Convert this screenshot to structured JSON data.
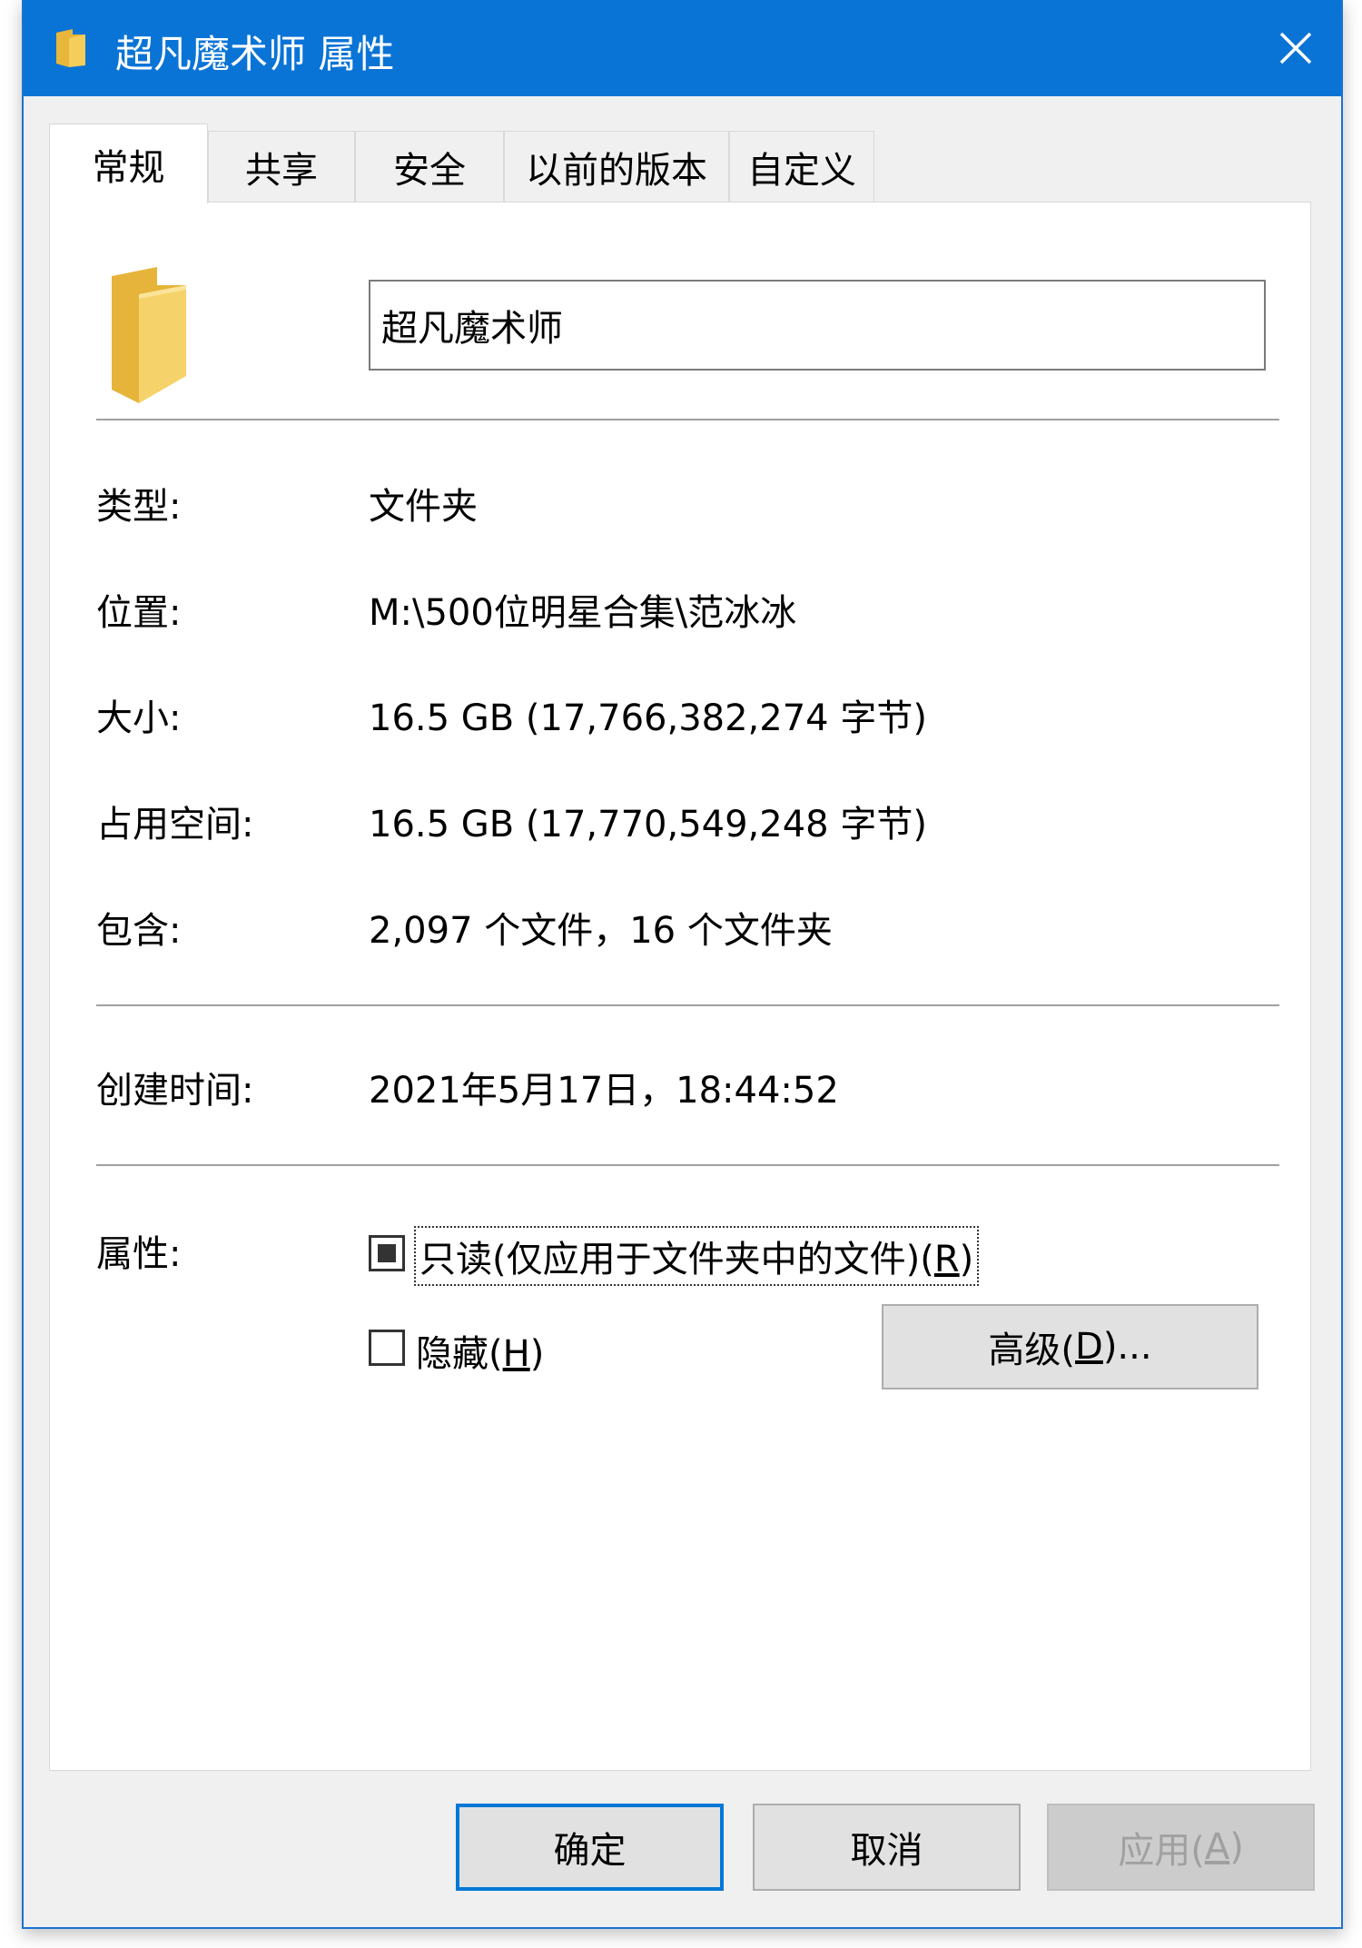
{
  "window": {
    "title": "超凡魔术师 属性",
    "close_icon": "close-icon"
  },
  "tabs": [
    {
      "label": "常规",
      "active": true
    },
    {
      "label": "共享",
      "active": false
    },
    {
      "label": "安全",
      "active": false
    },
    {
      "label": "以前的版本",
      "active": false
    },
    {
      "label": "自定义",
      "active": false
    }
  ],
  "general": {
    "folder_icon": "folder-icon",
    "name_value": "超凡魔术师",
    "rows": [
      {
        "label": "类型:",
        "value": "文件夹"
      },
      {
        "label": "位置:",
        "value": "M:\\500位明星合集\\范冰冰"
      },
      {
        "label": "大小:",
        "value": "16.5 GB (17,766,382,274 字节)"
      },
      {
        "label": "占用空间:",
        "value": "16.5 GB (17,770,549,248 字节)"
      },
      {
        "label": "包含:",
        "value": "2,097 个文件，16 个文件夹"
      }
    ],
    "created": {
      "label": "创建时间:",
      "value": "2021年5月17日，18:44:52"
    },
    "attributes": {
      "label": "属性:",
      "readonly": {
        "label_pre": "只读(仅应用于文件夹中的文件)(",
        "accel": "R",
        "label_post": ")",
        "state": "indeterminate"
      },
      "hidden": {
        "label_pre": "隐藏(",
        "accel": "H",
        "label_post": ")",
        "state": "unchecked"
      },
      "advanced": {
        "label_pre": "高级(",
        "accel": "D",
        "label_post": ")..."
      }
    }
  },
  "buttons": {
    "ok": "确定",
    "cancel": "取消",
    "apply_pre": "应用(",
    "apply_accel": "A",
    "apply_post": ")"
  }
}
